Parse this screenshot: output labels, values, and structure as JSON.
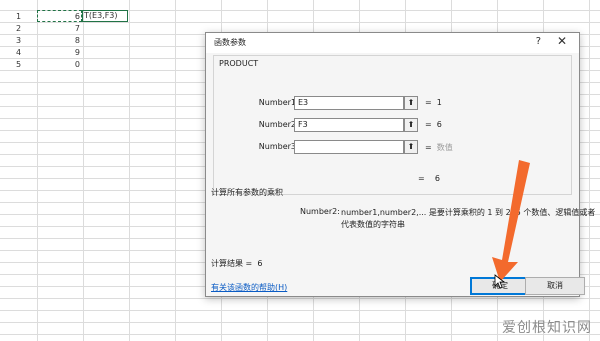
{
  "sheet": {
    "rows": [
      {
        "num": "1",
        "value": "6"
      },
      {
        "num": "2",
        "value": "7"
      },
      {
        "num": "3",
        "value": "8"
      },
      {
        "num": "4",
        "value": "9"
      },
      {
        "num": "5",
        "value": "0"
      }
    ],
    "formula_text": "=PRODUCT(E3,F3)",
    "formula_visible": "T(E3,F3)"
  },
  "dialog": {
    "title": "函数参数",
    "help_icon": "?",
    "close_icon": "✕",
    "function_name": "PRODUCT",
    "args": [
      {
        "label": "Number1",
        "value": "E3",
        "ref_icon": "⬆",
        "eq": "=",
        "result": "1"
      },
      {
        "label": "Number2",
        "value": "F3",
        "ref_icon": "⬆",
        "eq": "=",
        "result": "6"
      },
      {
        "label": "Number3",
        "value": "",
        "ref_icon": "⬆",
        "eq": "=",
        "result": "数值"
      }
    ],
    "overall_eq": "=",
    "overall_result": "6",
    "description": "计算所有参数的乘积",
    "arg_name": "Number2:",
    "arg_desc_line1": "number1,number2,... 是要计算乘积的 1 到 255 个数值、逻辑值或者",
    "arg_desc_line2": "代表数值的字符串",
    "calc_result_label": "计算结果 =",
    "calc_result_value": "6",
    "help_link": "有关该函数的帮助(H)",
    "ok_label": "确定",
    "cancel_label": "取消"
  },
  "watermark": "爱创根知识网",
  "colors": {
    "accent": "#0078d7",
    "arrow": "#f36a2d",
    "selection": "#217346",
    "link": "#0a5bc4"
  },
  "icons": {
    "reference_picker": "upload-arrow-icon",
    "cursor": "mouse-pointer-icon",
    "annotation": "orange-arrow-icon"
  }
}
